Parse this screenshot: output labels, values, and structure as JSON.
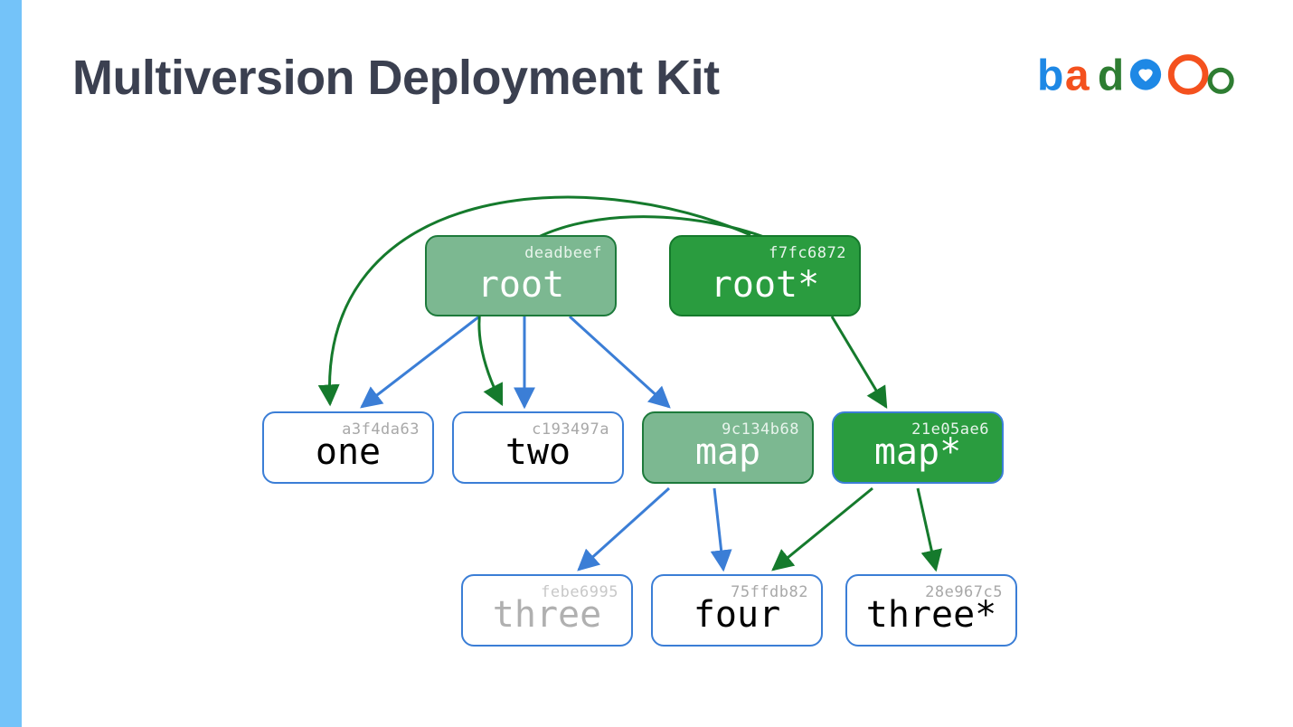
{
  "title": "Multiversion Deployment Kit",
  "logo": "badoo",
  "nodes": {
    "root": {
      "hash": "deadbeef",
      "label": "root"
    },
    "rootS": {
      "hash": "f7fc6872",
      "label": "root*"
    },
    "one": {
      "hash": "a3f4da63",
      "label": "one"
    },
    "two": {
      "hash": "c193497a",
      "label": "two"
    },
    "map": {
      "hash": "9c134b68",
      "label": "map"
    },
    "mapS": {
      "hash": "21e05ae6",
      "label": "map*"
    },
    "three": {
      "hash": "febe6995",
      "label": "three"
    },
    "four": {
      "hash": "75ffdb82",
      "label": "four"
    },
    "threeS": {
      "hash": "28e967c5",
      "label": "three*"
    }
  },
  "edges": [
    {
      "from": "root",
      "to": "one",
      "color": "blue"
    },
    {
      "from": "root",
      "to": "two",
      "color": "blue"
    },
    {
      "from": "root",
      "to": "map",
      "color": "blue"
    },
    {
      "from": "rootS",
      "to": "one",
      "color": "green"
    },
    {
      "from": "rootS",
      "to": "two",
      "color": "green"
    },
    {
      "from": "rootS",
      "to": "mapS",
      "color": "green"
    },
    {
      "from": "map",
      "to": "three",
      "color": "blue"
    },
    {
      "from": "map",
      "to": "four",
      "color": "blue"
    },
    {
      "from": "mapS",
      "to": "four",
      "color": "green"
    },
    {
      "from": "mapS",
      "to": "threeS",
      "color": "green"
    }
  ]
}
